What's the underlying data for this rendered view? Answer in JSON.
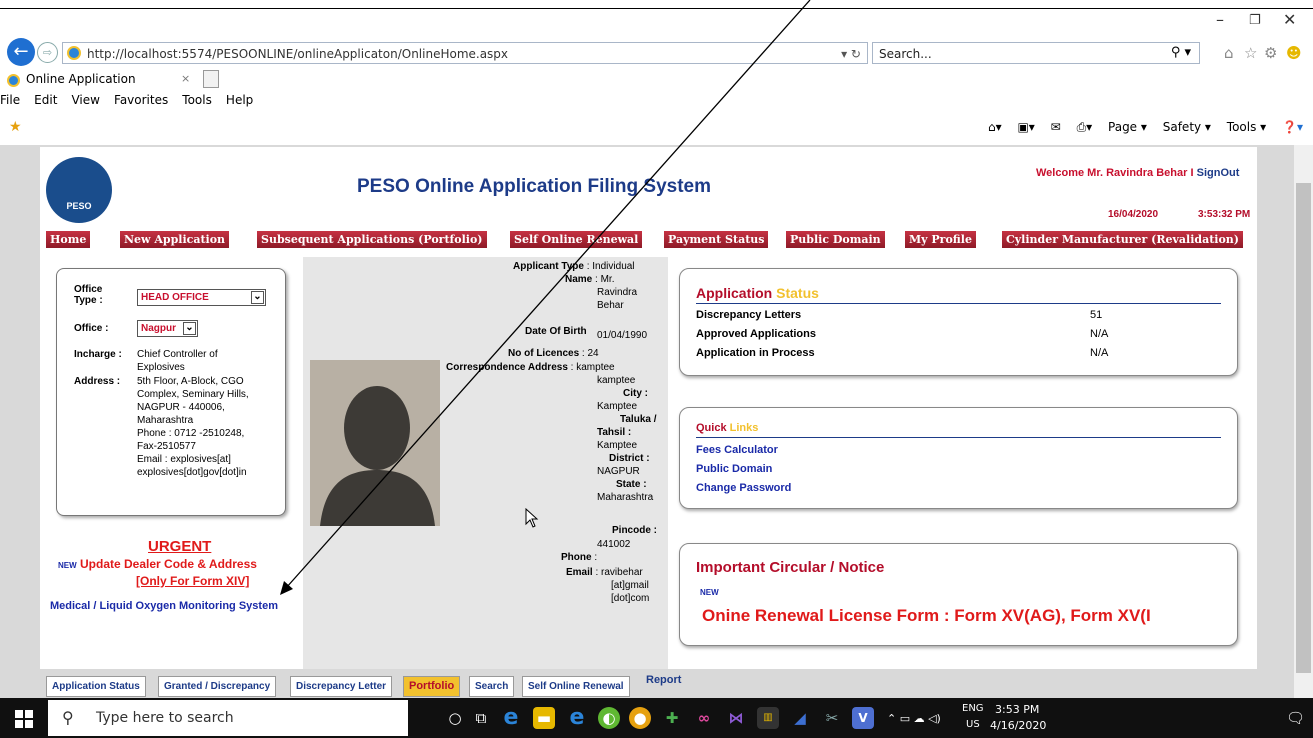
{
  "browser": {
    "url": "http://localhost:5574/PESOONLINE/onlineApplicaton/OnlineHome.aspx",
    "search_placeholder": "Search...",
    "tab_title": "Online Application",
    "menu": [
      "File",
      "Edit",
      "View",
      "Favorites",
      "Tools",
      "Help"
    ],
    "command_bar": [
      "Page ▾",
      "Safety ▾",
      "Tools ▾"
    ]
  },
  "header": {
    "emblem_text": "PESO",
    "title": "PESO Online Application Filing System",
    "welcome_prefix": "Welcome",
    "user_name": "Mr. Ravindra Behar",
    "separator": "I",
    "signout": "SignOut",
    "date": "16/04/2020",
    "time": "3:53:32 PM"
  },
  "nav": [
    "Home",
    "New Application",
    "Subsequent Applications (Portfolio)",
    "Self Online Renewal",
    "Payment Status",
    "Public Domain",
    "My Profile",
    "Cylinder Manufacturer (Revalidation)"
  ],
  "office": {
    "type_label": "Office Type :",
    "type_value": "HEAD OFFICE",
    "office_label": "Office :",
    "office_value": "Nagpur",
    "incharge_label": "Incharge :",
    "incharge_value": [
      "Chief Controller of",
      "Explosives"
    ],
    "address_label": "Address :",
    "address_value": [
      "5th Floor, A-Block, CGO",
      "Complex, Seminary Hills,",
      "NAGPUR - 440006,",
      "Maharashtra",
      "Phone : 0712 -2510248,",
      "Fax-2510577",
      "Email : explosives[at]",
      "explosives[dot]gov[dot]in"
    ]
  },
  "notice_left": {
    "urgent": "URGENT",
    "new_badge": "NEW",
    "update": "Update Dealer Code & Address",
    "only_form": "[Only For Form XIV]",
    "medical": "Medical / Liquid Oxygen Monitoring System"
  },
  "applicant": {
    "type_label": "Applicant Type",
    "type_value": "Individual",
    "name_label": "Name",
    "name_value": [
      "Mr.",
      "Ravindra",
      "Behar"
    ],
    "dob_label": "Date Of Birth",
    "dob_value": "01/04/1990",
    "licences_label": "No of Licences",
    "licences_value": "24",
    "corr_label": "Correspondence Address",
    "corr_value": [
      "kamptee",
      "kamptee"
    ],
    "city_label": "City :",
    "city_value": "Kamptee",
    "taluka_label": [
      "Taluka /",
      "Tahsil :"
    ],
    "taluka_value": "Kamptee",
    "district_label": "District :",
    "district_value": "NAGPUR",
    "state_label": "State :",
    "state_value": "Maharashtra",
    "pincode_label": "Pincode :",
    "pincode_value": "441002",
    "phone_label": "Phone",
    "email_label": "Email",
    "email_value": [
      "ravibehar",
      "[at]gmail",
      "[dot]com"
    ]
  },
  "status_panel": {
    "title_a": "Application",
    "title_b": "Status",
    "rows": [
      {
        "label": "Discrepancy Letters",
        "value": "51"
      },
      {
        "label": "Approved Applications",
        "value": "N/A"
      },
      {
        "label": "Application in Process",
        "value": "N/A"
      }
    ]
  },
  "quick_panel": {
    "title_a": "Quick",
    "title_b": "Links",
    "links": [
      "Fees Calculator",
      "Public Domain",
      "Change Password"
    ]
  },
  "circular_panel": {
    "title": "Important Circular / Notice",
    "new_badge": "NEW",
    "marquee": "Onine Renewal License Form : Form XV(AG), Form XV(I"
  },
  "bottom_tabs": [
    "Application Status",
    "Granted / Discrepancy",
    "Discrepancy Letter",
    "Portfolio",
    "Search",
    "Self Online Renewal",
    "Report"
  ],
  "taskbar": {
    "search_placeholder": "Type here to search",
    "lang": "ENG",
    "region": "US",
    "time": "3:53 PM",
    "date": "4/16/2020"
  }
}
